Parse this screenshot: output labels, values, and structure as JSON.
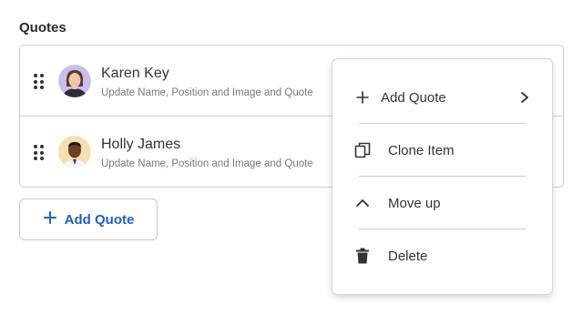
{
  "section": {
    "title": "Quotes"
  },
  "quotes": [
    {
      "name": "Karen Key",
      "subtitle": "Update Name, Position and Image and Quote",
      "avatar_icon": "woman-portrait-avatar"
    },
    {
      "name": "Holly James",
      "subtitle": "Update Name, Position and Image and Quote",
      "avatar_icon": "man-portrait-avatar"
    }
  ],
  "add_button": {
    "label": "Add Quote",
    "icon": "plus-icon",
    "color": "#1f5fd1"
  },
  "context_menu": {
    "items": [
      {
        "label": "Add Quote",
        "icon": "plus-icon",
        "has_submenu": true
      },
      {
        "label": "Clone Item",
        "icon": "clone-icon"
      },
      {
        "label": "Move up",
        "icon": "chevron-up-icon"
      },
      {
        "label": "Delete",
        "icon": "trash-icon"
      }
    ]
  }
}
